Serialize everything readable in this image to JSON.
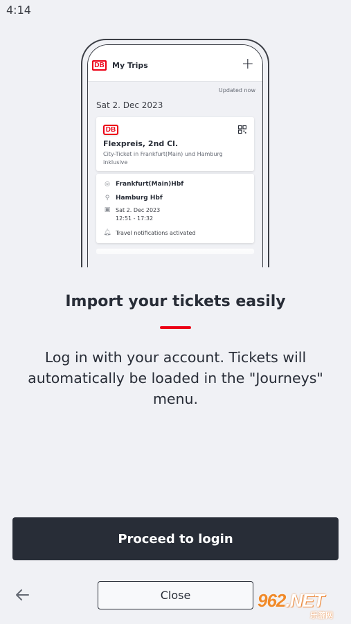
{
  "status_bar": {
    "time": "4:14"
  },
  "mockup": {
    "logo": "DB",
    "app_title": "My Trips",
    "plus": "+",
    "updated": "Updated now",
    "trip_date": "Sat 2. Dec 2023",
    "ticket": {
      "logo": "DB",
      "title": "Flexpreis, 2nd Cl.",
      "subtitle": "City-Ticket in Frankfurt(Main) und Hamburg inklusive"
    },
    "journey": {
      "origin": "Frankfurt(Main)Hbf",
      "destination": "Hamburg Hbf",
      "date": "Sat 2. Dec 2023",
      "time": "12:51 - 17:32",
      "notification": "Travel notifications activated"
    }
  },
  "onboarding": {
    "heading": "Import your tickets easily",
    "description": "Log in with your account. Tickets will automatically be loaded in the \"Journeys\" menu."
  },
  "buttons": {
    "proceed": "Proceed to login",
    "close": "Close"
  },
  "watermark": {
    "brand": "962",
    "suffix": ".NET",
    "sub": "乐游网"
  },
  "colors": {
    "accent": "#ec0016",
    "dark": "#282d37",
    "background": "#f0f1f5"
  }
}
